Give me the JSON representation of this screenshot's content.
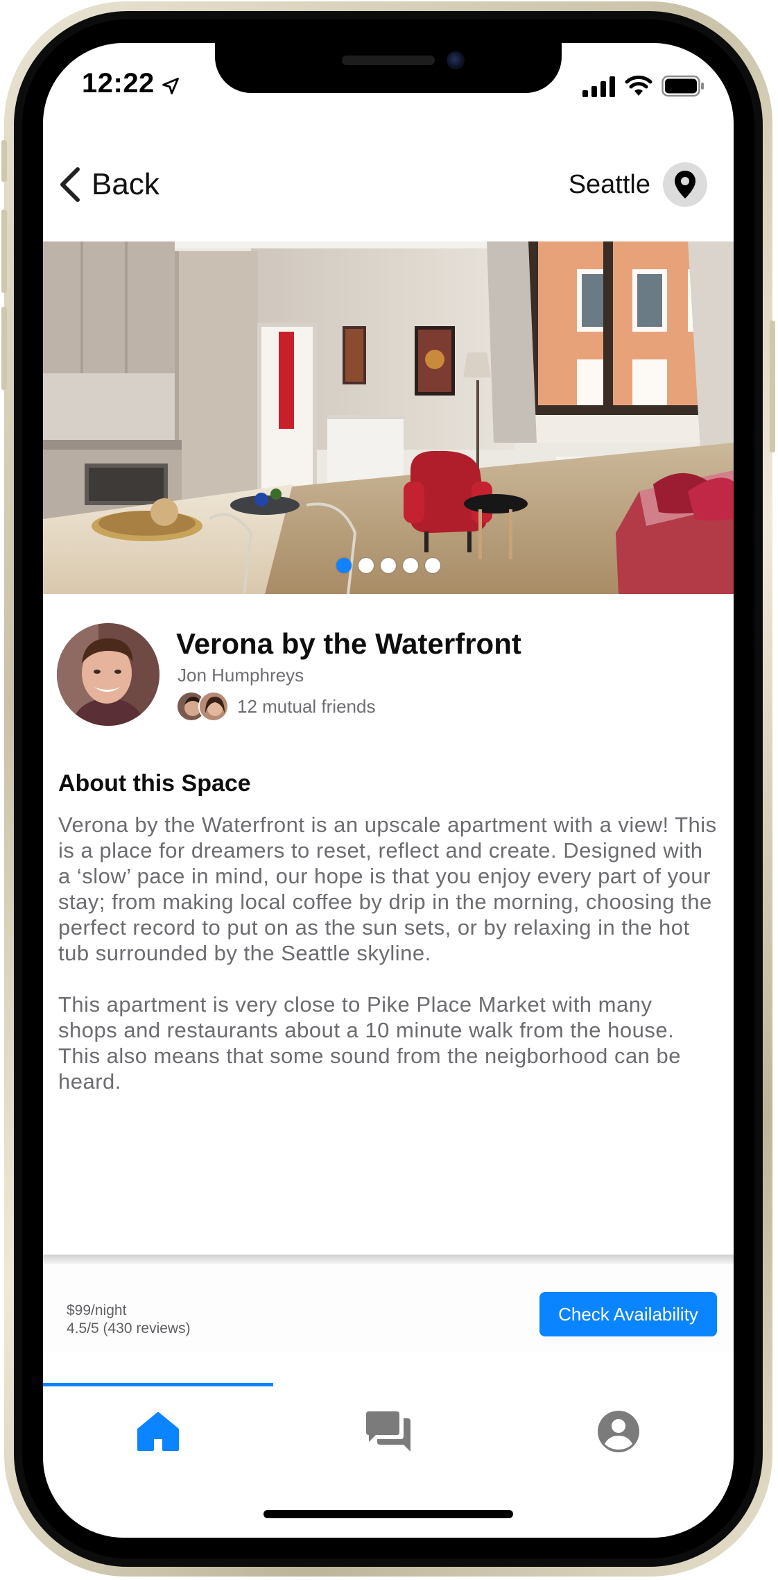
{
  "status_bar": {
    "time": "12:22",
    "location_icon": "location-arrow-icon",
    "signal_icon": "cellular-signal-icon",
    "wifi_icon": "wifi-icon",
    "battery_icon": "battery-icon"
  },
  "nav": {
    "back_label": "Back",
    "city": "Seattle",
    "pin_icon": "map-pin-icon"
  },
  "gallery": {
    "dot_count": 5,
    "active_index": 0
  },
  "listing": {
    "title": "Verona by the Waterfront",
    "host_name": "Jon Humphreys",
    "mutual_friends": "12 mutual friends"
  },
  "about": {
    "heading": "About this Space",
    "paragraphs": [
      "Verona by the Waterfront is an upscale apartment with a view! This is a place for dreamers to reset, reflect and create. Designed with a ‘slow’ pace in mind, our hope is that you enjoy every part of your stay; from making local coffee by drip in the morning, choosing the perfect record to put on as the sun sets, or by relaxing in the hot tub surrounded by the Seattle skyline.",
      "This apartment is very close to Pike Place Market with many shops and restaurants about a 10 minute walk from the house. This also means that some sound from the neigborhood can be heard."
    ]
  },
  "booking": {
    "price": "$99/night",
    "rating": "4.5/5 (430 reviews)",
    "cta": "Check Availability"
  },
  "tabs": [
    {
      "name": "home",
      "icon": "home-icon",
      "active": true
    },
    {
      "name": "messages",
      "icon": "chat-icon",
      "active": false
    },
    {
      "name": "profile",
      "icon": "account-circle-icon",
      "active": false
    }
  ],
  "colors": {
    "accent": "#0a84ff",
    "inactive_icon": "#7b7b7b",
    "body_text": "#6b6c70"
  }
}
